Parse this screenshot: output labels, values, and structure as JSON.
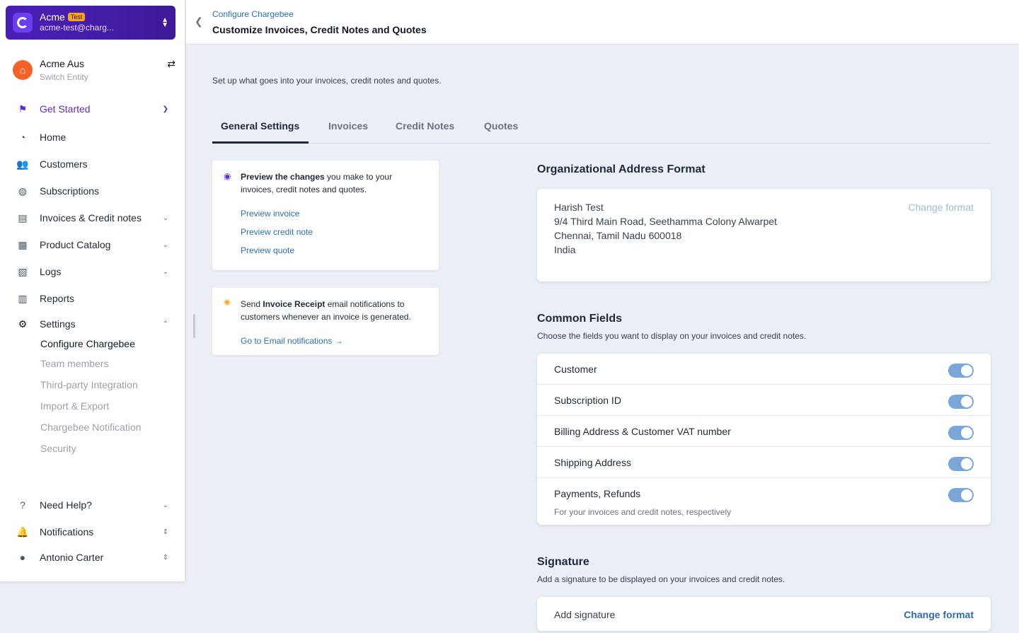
{
  "account": {
    "name": "Acme",
    "badge": "Test",
    "email": "acme-test@charg..."
  },
  "entity": {
    "initial": "⌂",
    "name": "Acme Aus",
    "sub": "Switch Entity"
  },
  "nav": {
    "get_started": "Get Started",
    "home": "Home",
    "customers": "Customers",
    "subscriptions": "Subscriptions",
    "invoices": "Invoices & Credit notes",
    "product_catalog": "Product Catalog",
    "logs": "Logs",
    "reports": "Reports",
    "settings": "Settings",
    "settings_sub": [
      "Configure Chargebee",
      "Team members",
      "Third-party Integration",
      "Import & Export",
      "Chargebee Notification",
      "Security"
    ],
    "need_help": "Need Help?",
    "notifications": "Notifications",
    "user": "Antonio Carter"
  },
  "header": {
    "breadcrumb": "Configure Chargebee",
    "title": "Customize Invoices, Credit Notes and Quotes"
  },
  "intro": "Set up what goes into your invoices, credit notes and quotes.",
  "tabs": [
    "General Settings",
    "Invoices",
    "Credit Notes",
    "Quotes"
  ],
  "preview_card": {
    "bold": "Preview the changes",
    "rest": " you make to your invoices, credit notes and quotes.",
    "links": [
      "Preview invoice",
      "Preview credit note",
      "Preview quote"
    ]
  },
  "email_card": {
    "pre": "Send ",
    "bold": "Invoice Receipt",
    "rest": " email notifications to customers whenever an invoice is generated.",
    "link": "Go to Email notifications"
  },
  "address_section": {
    "title": "Organizational Address Format",
    "lines": [
      "Harish Test",
      "9/4 Third Main Road, Seethamma Colony Alwarpet",
      "Chennai, Tamil Nadu 600018",
      "India"
    ],
    "change": "Change format"
  },
  "common_fields": {
    "title": "Common Fields",
    "subtitle": "Choose the fields you want to display on your invoices and credit notes.",
    "rows": [
      {
        "label": "Customer",
        "enabled": true
      },
      {
        "label": "Subscription ID",
        "enabled": true
      },
      {
        "label": "Billing Address & Customer VAT number",
        "enabled": true
      },
      {
        "label": "Shipping Address",
        "enabled": true
      },
      {
        "label": "Payments, Refunds",
        "sub": "For your invoices and credit notes, respectively",
        "enabled": true
      }
    ]
  },
  "signature": {
    "title": "Signature",
    "subtitle": "Add a signature to be displayed on your invoices and credit notes.",
    "label": "Add signature",
    "change": "Change format"
  },
  "colors": {
    "brand": "#5b2bd6",
    "link": "#2f6fb8",
    "toggle_on": "#7aa7d8"
  }
}
